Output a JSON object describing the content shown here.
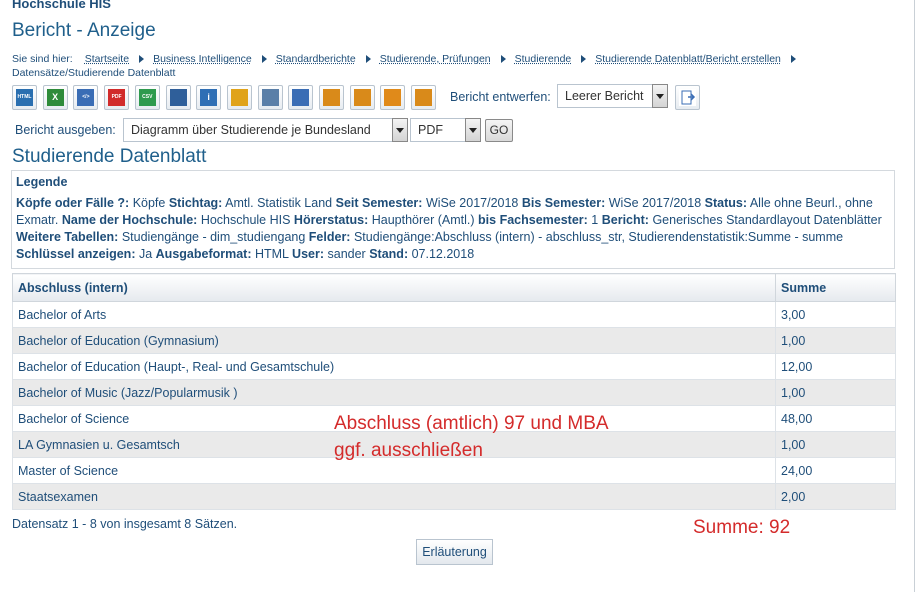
{
  "header": {
    "org": "Hochschule HIS",
    "page_title": "Bericht - Anzeige"
  },
  "breadcrumb": {
    "prefix": "Sie sind hier:",
    "items": [
      "Startseite",
      "Business Intelligence",
      "Standardberichte",
      "Studierende, Prüfungen",
      "Studierende",
      "Studierende Datenblatt/Bericht erstellen"
    ],
    "current": "Datensätze/Studierende Datenblatt"
  },
  "toolbar": {
    "icons": [
      {
        "name": "html-icon",
        "text": "HTML",
        "color": "#2a6fb0"
      },
      {
        "name": "excel-icon",
        "text": "X",
        "color": "#2e8b3a"
      },
      {
        "name": "xml-icon",
        "text": "</>",
        "color": "#3a6db5"
      },
      {
        "name": "pdf-icon",
        "text": "PDF",
        "color": "#d12b2b"
      },
      {
        "name": "csv-icon",
        "text": "CSV",
        "color": "#2e9a4e"
      },
      {
        "name": "copy-icon",
        "text": "",
        "color": "#2f5f9a"
      },
      {
        "name": "info-icon",
        "text": "i",
        "color": "#2f6fb5"
      },
      {
        "name": "bookmark-icon",
        "text": "",
        "color": "#e0a31a"
      },
      {
        "name": "attachment-icon",
        "text": "",
        "color": "#5a7fa8"
      },
      {
        "name": "link-icon",
        "text": "",
        "color": "#3a6db5"
      },
      {
        "name": "edit-report-icon",
        "text": "",
        "color": "#d98a1a"
      },
      {
        "name": "open-book-icon",
        "text": "",
        "color": "#d98a1a"
      },
      {
        "name": "folder-icon",
        "text": "",
        "color": "#e08a1a"
      },
      {
        "name": "export-icon",
        "text": "",
        "color": "#d98a1a"
      }
    ],
    "design_label": "Bericht entwerfen:",
    "design_value": "Leerer Bericht"
  },
  "output": {
    "label": "Bericht ausgeben:",
    "report_value": "Diagramm über Studierende je Bundesland",
    "format_value": "PDF",
    "go_label": "GO"
  },
  "section_title": "Studierende Datenblatt",
  "legend": {
    "title": "Legende",
    "items": [
      {
        "k": "Köpfe oder Fälle ?:",
        "v": "Köpfe"
      },
      {
        "k": "Stichtag:",
        "v": "Amtl. Statistik Land"
      },
      {
        "k": "Seit Semester:",
        "v": "WiSe 2017/2018"
      },
      {
        "k": "Bis Semester:",
        "v": "WiSe 2017/2018"
      },
      {
        "k": "Status:",
        "v": "Alle ohne Beurl., ohne Exmatr."
      },
      {
        "k": "Name der Hochschule:",
        "v": "Hochschule HIS"
      },
      {
        "k": "Hörerstatus:",
        "v": "Haupthörer (Amtl.)"
      },
      {
        "k": "bis Fachsemester:",
        "v": "1"
      },
      {
        "k": "Bericht:",
        "v": "Generisches Standardlayout Datenblätter"
      },
      {
        "k": "Weitere Tabellen:",
        "v": "Studiengänge - dim_studiengang"
      },
      {
        "k": "Felder:",
        "v": "Studiengänge:Abschluss (intern) - abschluss_str, Studierendenstatistik:Summe - summe"
      },
      {
        "k": "Schlüssel anzeigen:",
        "v": "Ja"
      },
      {
        "k": "Ausgabeformat:",
        "v": "HTML"
      },
      {
        "k": "User:",
        "v": "sander"
      },
      {
        "k": "Stand:",
        "v": "07.12.2018"
      }
    ]
  },
  "table": {
    "headers": [
      "Abschluss (intern)",
      "Summe"
    ],
    "rows": [
      [
        "Bachelor of Arts",
        "3,00"
      ],
      [
        "Bachelor of Education (Gymnasium)",
        "1,00"
      ],
      [
        "Bachelor of Education (Haupt-, Real- und Gesamtschule)",
        "12,00"
      ],
      [
        "Bachelor of Music (Jazz/Popularmusik )",
        "1,00"
      ],
      [
        "Bachelor of Science",
        "48,00"
      ],
      [
        "LA Gymnasien u. Gesamtsch",
        "1,00"
      ],
      [
        "Master of Science",
        "24,00"
      ],
      [
        "Staatsexamen",
        "2,00"
      ]
    ]
  },
  "annotation": {
    "line1": "Abschluss (amtlich) 97 und MBA",
    "line2": "ggf. ausschließen",
    "sum": "Summe: 92",
    "color": "#d42b2b"
  },
  "footer": {
    "records": "Datensatz 1 - 8 von insgesamt 8 Sätzen.",
    "explain_label": "Erläuterung"
  }
}
